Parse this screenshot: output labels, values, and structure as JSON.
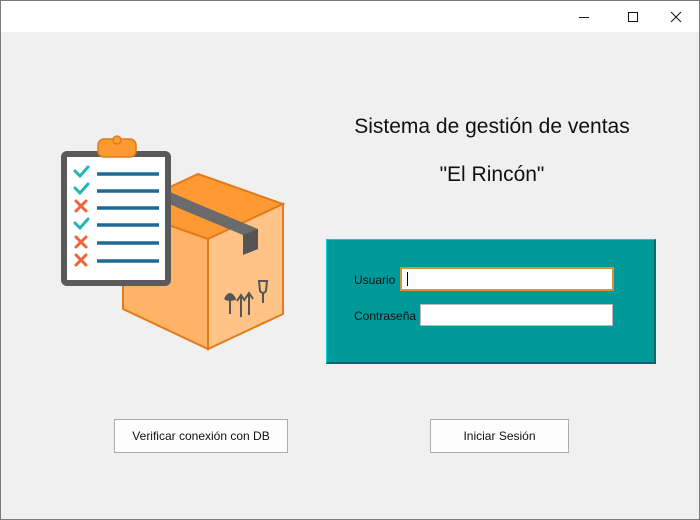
{
  "window": {
    "controls": [
      "minimize-icon",
      "maximize-icon",
      "close-icon"
    ]
  },
  "header": {
    "title": "Sistema de gestión de ventas",
    "subtitle": "\"El Rincón\""
  },
  "login": {
    "user_label": "Usuario",
    "user_value": "",
    "password_label": "Contraseña",
    "password_value": ""
  },
  "buttons": {
    "verify_label": "Verificar conexión con DB",
    "login_label": "Iniciar Sesión"
  },
  "illustration": {
    "icons": [
      "clipboard-checklist-icon",
      "shipping-box-icon"
    ],
    "colors": {
      "box_orange": "#ffb366",
      "box_dark_orange": "#ff9933",
      "tape": "#6b6b6b",
      "check": "#25b5b5",
      "cross": "#f0643c",
      "line": "#1e6b91"
    }
  },
  "theme": {
    "panel_color": "#009999",
    "focus_border": "#d4953a"
  }
}
